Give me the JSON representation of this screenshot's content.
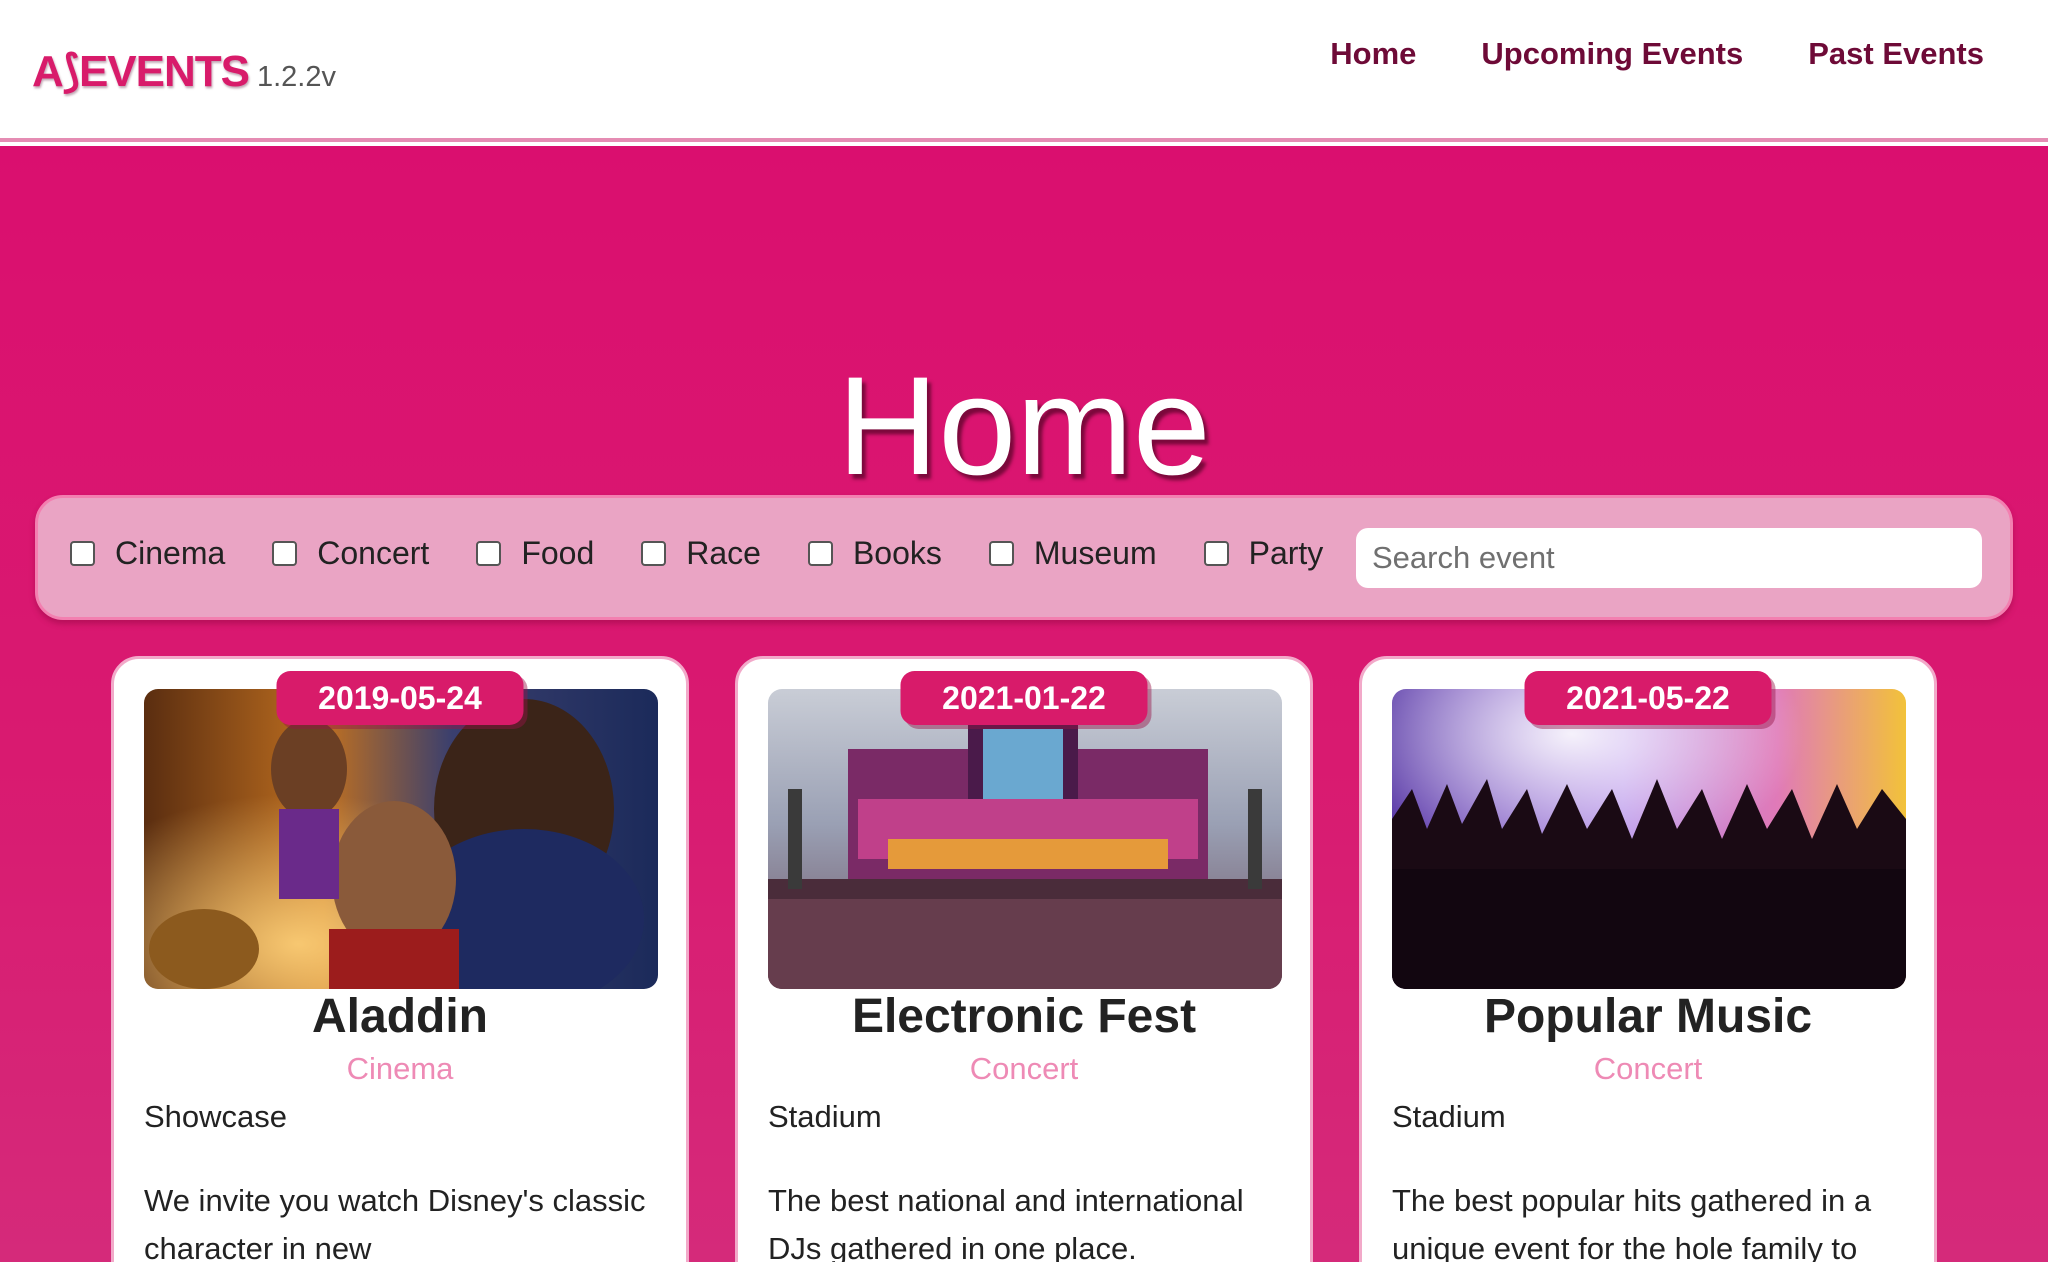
{
  "header": {
    "logo_text": "A⟆EVENTS",
    "version": "1.2.2v",
    "nav": [
      {
        "label": "Home"
      },
      {
        "label": "Upcoming Events"
      },
      {
        "label": "Past Events"
      }
    ]
  },
  "hero": {
    "title": "Home"
  },
  "filters": {
    "categories": [
      {
        "label": "Cinema",
        "checked": false
      },
      {
        "label": "Concert",
        "checked": false
      },
      {
        "label": "Food",
        "checked": false
      },
      {
        "label": "Race",
        "checked": false
      },
      {
        "label": "Books",
        "checked": false
      },
      {
        "label": "Museum",
        "checked": false
      },
      {
        "label": "Party",
        "checked": false
      }
    ],
    "search_placeholder": "Search event",
    "search_value": ""
  },
  "events": [
    {
      "date": "2019-05-24",
      "title": "Aladdin",
      "category": "Cinema",
      "venue": "Showcase",
      "description": "We invite you watch Disney's classic character in new"
    },
    {
      "date": "2021-01-22",
      "title": "Electronic Fest",
      "category": "Concert",
      "venue": "Stadium",
      "description": "The best national and international DJs gathered in one place."
    },
    {
      "date": "2021-05-22",
      "title": "Popular Music",
      "category": "Concert",
      "venue": "Stadium",
      "description": "The best popular hits gathered in a unique event for the hole family to"
    }
  ],
  "colors": {
    "brand": "#d81b6a",
    "nav_text": "#6e0a37",
    "filter_bar": "#eaa4c4",
    "category_text": "#ee8ab5"
  }
}
